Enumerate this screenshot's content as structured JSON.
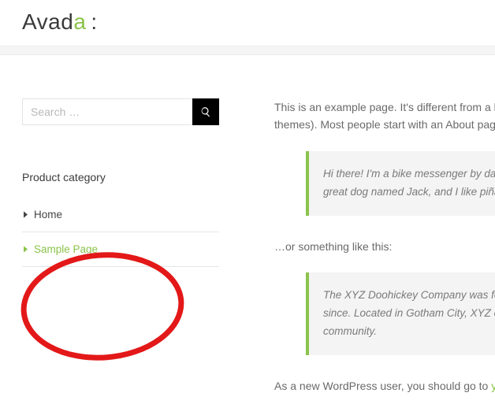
{
  "logo": {
    "brand_main": "Avad",
    "brand_accent": "a",
    "punct": ":"
  },
  "sidebar": {
    "search_placeholder": "Search …",
    "widget_title": "Product category",
    "nav_items": [
      {
        "label": "Home",
        "active": false
      },
      {
        "label": "Sample Page",
        "active": true
      }
    ]
  },
  "content": {
    "intro_line1": "This is an example page. It's different from a blo",
    "intro_line2": "themes). Most people start with an About page t",
    "quote1_line1": "Hi there! I'm a bike messenger by day",
    "quote1_line2": "great dog named Jack, and I like piña",
    "bridge": "…or something like this:",
    "quote2_line1": "The XYZ Doohickey Company was fou",
    "quote2_line2": "since. Located in Gotham City, XYZ em",
    "quote2_line3": "community.",
    "outro_prefix": "As a new WordPress user, you should go to ",
    "outro_link": "your"
  },
  "colors": {
    "accent": "#8bc34a",
    "annotation": "#e31818"
  }
}
